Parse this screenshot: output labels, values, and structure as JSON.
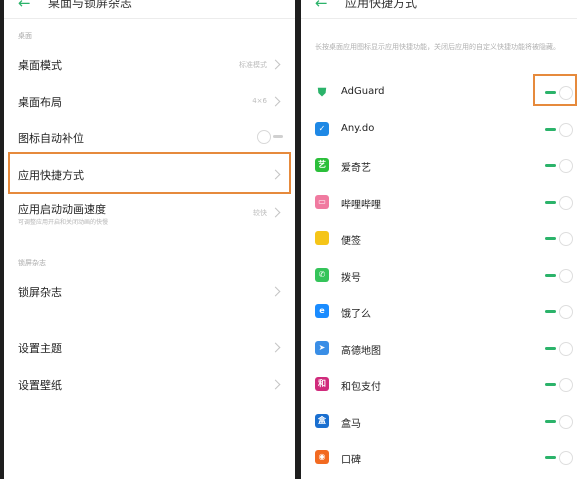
{
  "left": {
    "header": {
      "back_icon": "arrow-left-icon",
      "title": "桌面与锁屏杂志"
    },
    "section_desktop": "桌面",
    "desktop_mode": {
      "label": "桌面模式",
      "value": "标准模式"
    },
    "desktop_layout": {
      "label": "桌面布局",
      "value": "4×6"
    },
    "auto_fill": {
      "label": "图标自动补位",
      "enabled": false
    },
    "app_shortcuts": {
      "label": "应用快捷方式"
    },
    "launch_speed": {
      "label": "应用启动动画速度",
      "sublabel": "可调整应用开启和关闭动画的快慢",
      "value": "较快"
    },
    "section_lockscreen": "锁屏杂志",
    "lockscreen_magazine": {
      "label": "锁屏杂志"
    },
    "set_theme": {
      "label": "设置主题"
    },
    "set_wallpaper": {
      "label": "设置壁纸"
    }
  },
  "right": {
    "header": {
      "back_icon": "arrow-left-icon",
      "title": "应用快捷方式"
    },
    "description": "长按桌面应用图标显示应用快捷功能，关闭后应用的自定义快捷功能将被隐藏。",
    "toggle_color": "#2bb36a",
    "highlight_color": "#e68a3c",
    "apps": [
      {
        "name": "AdGuard",
        "icon": "adguard-shield-icon",
        "color": "#ffffff",
        "glyph": "⛊",
        "enabled": true
      },
      {
        "name": "Any.do",
        "icon": "anydo-check-icon",
        "color": "#1e88e5",
        "glyph": "✓",
        "enabled": true
      },
      {
        "name": "爱奇艺",
        "icon": "iqiyi-icon",
        "color": "#2bbf3a",
        "glyph": "艺",
        "enabled": true
      },
      {
        "name": "哔哩哔哩",
        "icon": "bilibili-tv-icon",
        "color": "#f07aa0",
        "glyph": "▭",
        "enabled": true
      },
      {
        "name": "便签",
        "icon": "note-icon",
        "color": "#f5c518",
        "glyph": "",
        "enabled": true
      },
      {
        "name": "拨号",
        "icon": "phone-icon",
        "color": "#35c45a",
        "glyph": "✆",
        "enabled": true
      },
      {
        "name": "饿了么",
        "icon": "eleme-icon",
        "color": "#1a8cff",
        "glyph": "e",
        "enabled": true
      },
      {
        "name": "高德地图",
        "icon": "amap-arrow-icon",
        "color": "#3a8ee6",
        "glyph": "➤",
        "enabled": true
      },
      {
        "name": "和包支付",
        "icon": "hebao-pay-icon",
        "color": "#d02b7c",
        "glyph": "和",
        "enabled": true
      },
      {
        "name": "盒马",
        "icon": "hema-icon",
        "color": "#1a6fd0",
        "glyph": "盒",
        "enabled": true
      },
      {
        "name": "口碑",
        "icon": "koubei-icon",
        "color": "#f26a21",
        "glyph": "◉",
        "enabled": true
      }
    ]
  }
}
